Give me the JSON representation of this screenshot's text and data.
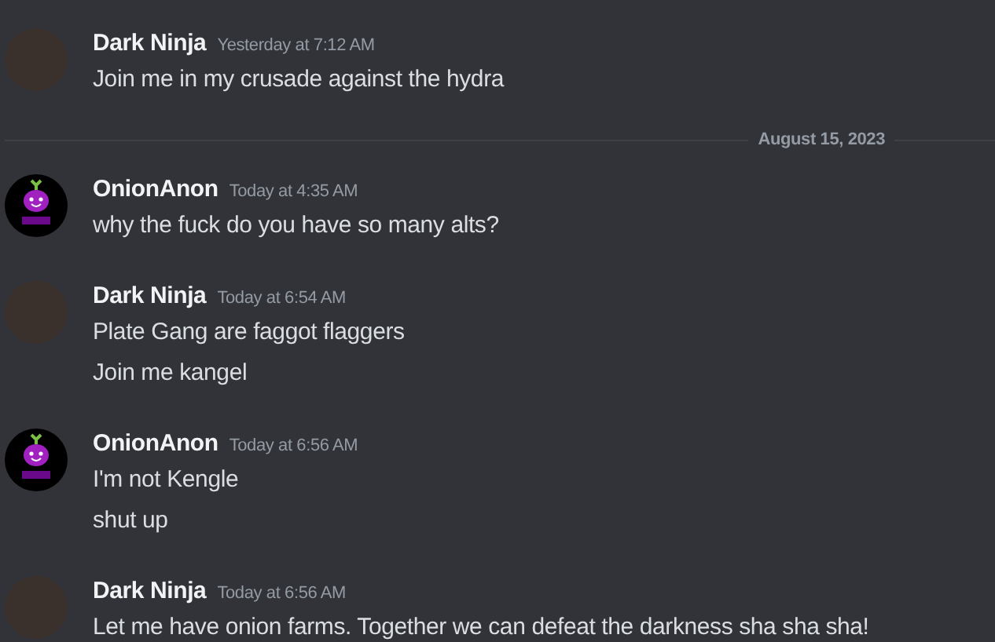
{
  "feed": [
    {
      "kind": "group",
      "author": "Dark Ninja",
      "avatar": {
        "kind": "photo"
      },
      "timestamp": "Yesterday at 7:12 AM",
      "messages": [
        "Join me in my crusade against the hydra"
      ]
    },
    {
      "kind": "divider",
      "label": "August 15, 2023"
    },
    {
      "kind": "group",
      "author": "OnionAnon",
      "avatar": {
        "kind": "onion"
      },
      "timestamp": "Today at 4:35 AM",
      "messages": [
        "why the fuck do you have so many alts?"
      ]
    },
    {
      "kind": "group",
      "author": "Dark Ninja",
      "avatar": {
        "kind": "photo"
      },
      "timestamp": "Today at 6:54 AM",
      "messages": [
        "Plate Gang are faggot flaggers",
        "Join me kangel"
      ]
    },
    {
      "kind": "group",
      "author": "OnionAnon",
      "avatar": {
        "kind": "onion"
      },
      "timestamp": "Today at 6:56 AM",
      "messages": [
        "I'm not Kengle",
        "shut up"
      ]
    },
    {
      "kind": "group",
      "author": "Dark Ninja",
      "avatar": {
        "kind": "photo"
      },
      "timestamp": "Today at 6:56 AM",
      "messages": [
        "Let me have onion farms. Together we can defeat the darkness sha sha sha!"
      ]
    }
  ]
}
